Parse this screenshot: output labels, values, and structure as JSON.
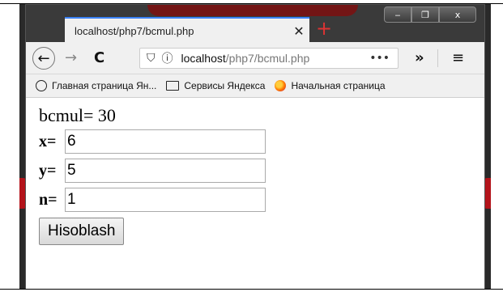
{
  "window": {
    "minimize_glyph": "‒",
    "restore_glyph": "❐",
    "close_glyph": "x"
  },
  "tab": {
    "title": "localhost/php7/bcmul.php",
    "close_glyph": "✕",
    "new_tab_glyph": "+"
  },
  "navbar": {
    "back_glyph": "←",
    "forward_glyph": "→",
    "reload_glyph": "C",
    "shield_glyph": "⛉",
    "info_glyph": "ⓘ",
    "url_host": "localhost",
    "url_path": "/php7/bcmul.php",
    "page_actions_glyph": "•••",
    "overflow_glyph": "»",
    "menu_glyph": "≡"
  },
  "bookmarks": [
    {
      "label": "Главная страница Ян...",
      "icon": "globe-icon"
    },
    {
      "label": "Сервисы Яндекса",
      "icon": "folder-icon"
    },
    {
      "label": "Начальная страница",
      "icon": "firefox-icon"
    }
  ],
  "page": {
    "result_text": "bcmul= 30",
    "x_label": "x=",
    "x_value": "6",
    "y_label": "y=",
    "y_value": "5",
    "n_label": "n=",
    "n_value": "1",
    "submit_label": "Hisoblash"
  }
}
